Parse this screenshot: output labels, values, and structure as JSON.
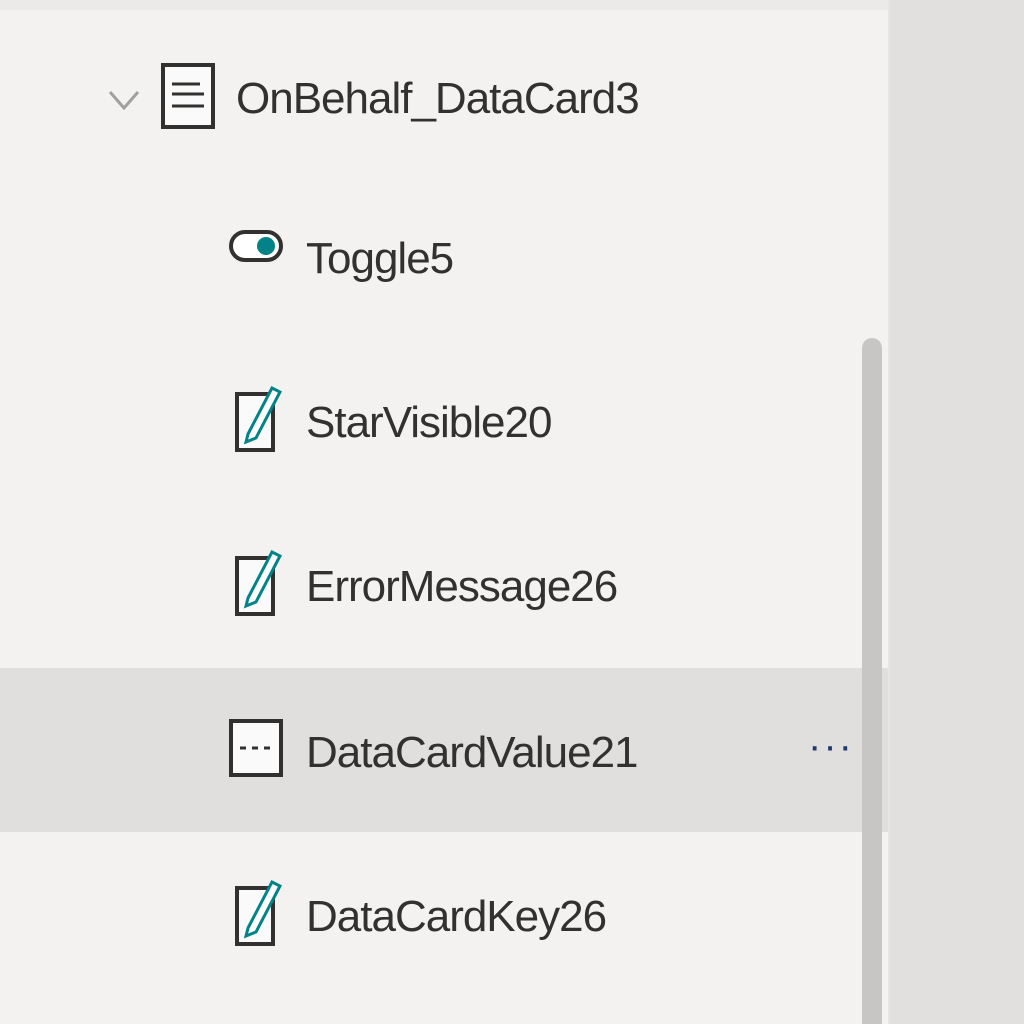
{
  "tree": {
    "parent": {
      "label": "OnBehalf_DataCard3",
      "icon": "data-card-icon",
      "expand_icon": "chevron-down-icon",
      "expanded": true
    },
    "children": [
      {
        "label": "Toggle5",
        "icon": "toggle-icon",
        "selected": false
      },
      {
        "label": "StarVisible20",
        "icon": "label-edit-icon",
        "selected": false
      },
      {
        "label": "ErrorMessage26",
        "icon": "label-edit-icon",
        "selected": false
      },
      {
        "label": "DataCardValue21",
        "icon": "text-input-icon",
        "selected": true,
        "more_label": "···"
      },
      {
        "label": "DataCardKey26",
        "icon": "label-edit-icon",
        "selected": false
      }
    ]
  },
  "colors": {
    "panel_bg": "#f3f2f1",
    "selected_bg": "#e1dfdd",
    "accent_teal": "#038387",
    "text": "#323130",
    "right_panel_bg": "#e1e0df"
  }
}
